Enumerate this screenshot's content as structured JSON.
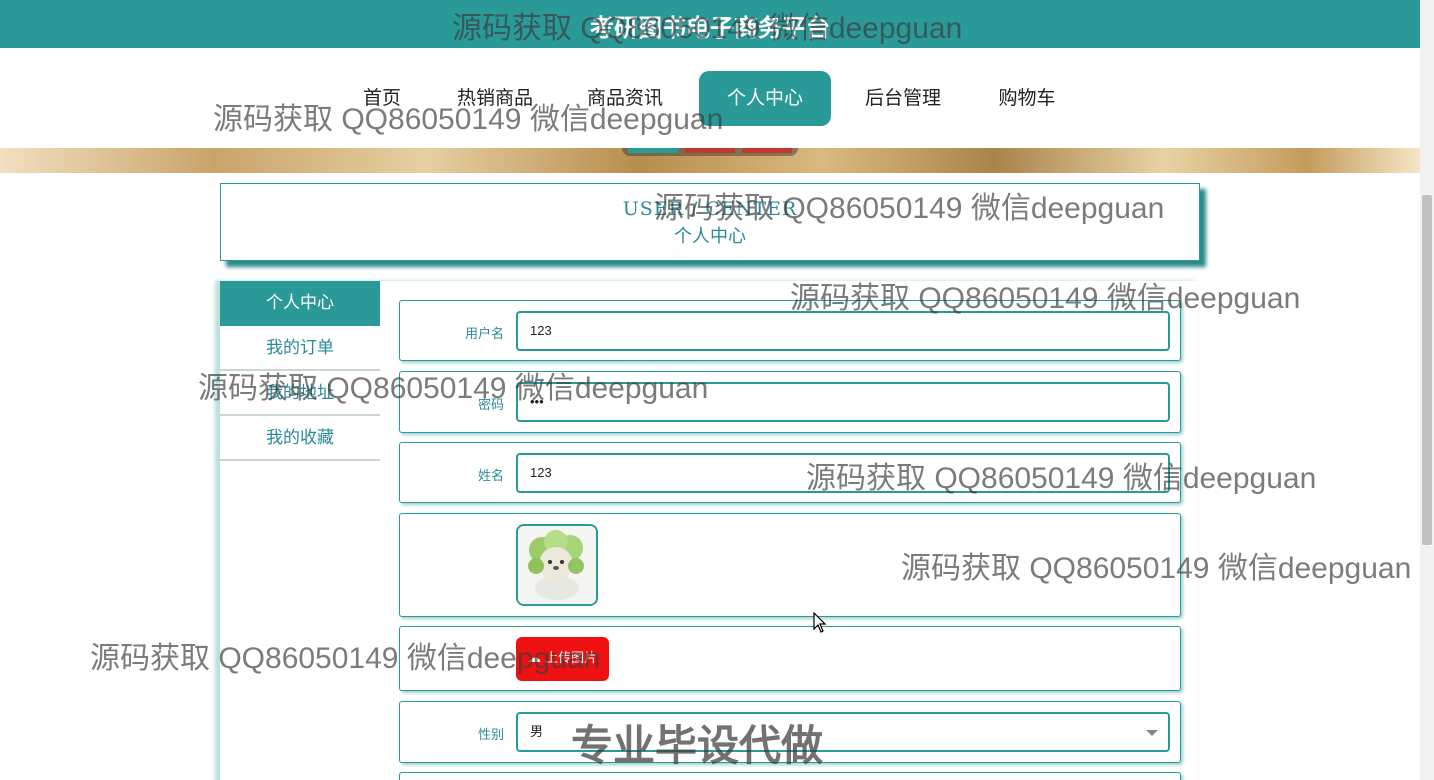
{
  "site": {
    "title": "考研图书电子商务平台"
  },
  "nav": {
    "items": [
      {
        "label": "首页"
      },
      {
        "label": "热销商品"
      },
      {
        "label": "商品资讯"
      },
      {
        "label": "个人中心"
      },
      {
        "label": "后台管理"
      },
      {
        "label": "购物车"
      }
    ],
    "active": "个人中心"
  },
  "user_center": {
    "title_en": "USER / CENTER",
    "title_cn": "个人中心"
  },
  "side_menu": {
    "items": [
      {
        "label": "个人中心"
      },
      {
        "label": "我的订单"
      },
      {
        "label": "我的地址"
      },
      {
        "label": "我的收藏"
      }
    ]
  },
  "form": {
    "username": {
      "label": "用户名",
      "value": "123"
    },
    "password": {
      "label": "密码",
      "value": "•••"
    },
    "name": {
      "label": "姓名",
      "value": "123"
    },
    "avatar": {
      "icon": "cabbage-dog-avatar"
    },
    "upload": {
      "label": "上传图片",
      "icon": "upload-icon"
    },
    "gender": {
      "label": "性别",
      "value": "男"
    }
  },
  "watermarks": {
    "contact": "源码获取 QQ86050149 微信deepguan",
    "service": "专业毕设代做"
  },
  "colors": {
    "primary": "#2a9a99",
    "upload": "#ee1111"
  }
}
